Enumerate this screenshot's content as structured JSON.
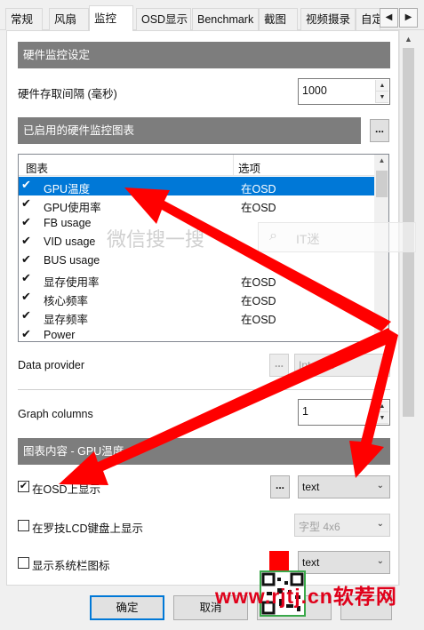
{
  "tabs": [
    "常规",
    "风扇",
    "监控",
    "OSD显示",
    "Benchmark",
    "截图",
    "视频摄录",
    "自定"
  ],
  "hw_section_title": "硬件监控设定",
  "polling_label": "硬件存取间隔 (毫秒)",
  "polling_value": "1000",
  "enabled_graphs_title": "已启用的硬件监控图表",
  "dots": "...",
  "list_headers": {
    "graph": "图表",
    "options": "选项"
  },
  "list_rows": [
    {
      "name": "GPU温度",
      "option": "在OSD",
      "checked": true,
      "selected": true
    },
    {
      "name": "GPU使用率",
      "option": "在OSD",
      "checked": true,
      "selected": false
    },
    {
      "name": "FB usage",
      "option": "",
      "checked": true,
      "selected": false
    },
    {
      "name": "VID usage",
      "option": "",
      "checked": true,
      "selected": false
    },
    {
      "name": "BUS usage",
      "option": "",
      "checked": true,
      "selected": false
    },
    {
      "name": "显存使用率",
      "option": "在OSD",
      "checked": true,
      "selected": false
    },
    {
      "name": "核心频率",
      "option": "在OSD",
      "checked": true,
      "selected": false
    },
    {
      "name": "显存频率",
      "option": "在OSD",
      "checked": true,
      "selected": false
    },
    {
      "name": "Power",
      "option": "",
      "checked": true,
      "selected": false
    }
  ],
  "data_provider_label": "Data provider",
  "data_provider_value": "Internal",
  "graph_columns_label": "Graph columns",
  "graph_columns_value": "1",
  "graph_content_title": "图表内容 - GPU温度",
  "osd_check_label": "在OSD上显示",
  "osd_combo": "text",
  "lcd_check_label": "在罗技LCD键盘上显示",
  "lcd_combo": "字型 4x6",
  "tray_check_label": "显示系统栏图标",
  "tray_combo": "text",
  "buttons": {
    "ok": "确定",
    "cancel": "取消"
  },
  "watermark": {
    "search_text": "微信搜一搜",
    "search_box": "IT迷",
    "url": "www.rjtj.cn软荐网"
  },
  "colors": {
    "selection": "#0078d7",
    "section_bar": "#7d7d7d",
    "swatch": "#ff0000",
    "arrow": "#ff0000"
  },
  "icons": {
    "check": "✔",
    "up": "▲",
    "down": "▼",
    "left": "◀",
    "right": "▶",
    "chevron": "⌄"
  }
}
